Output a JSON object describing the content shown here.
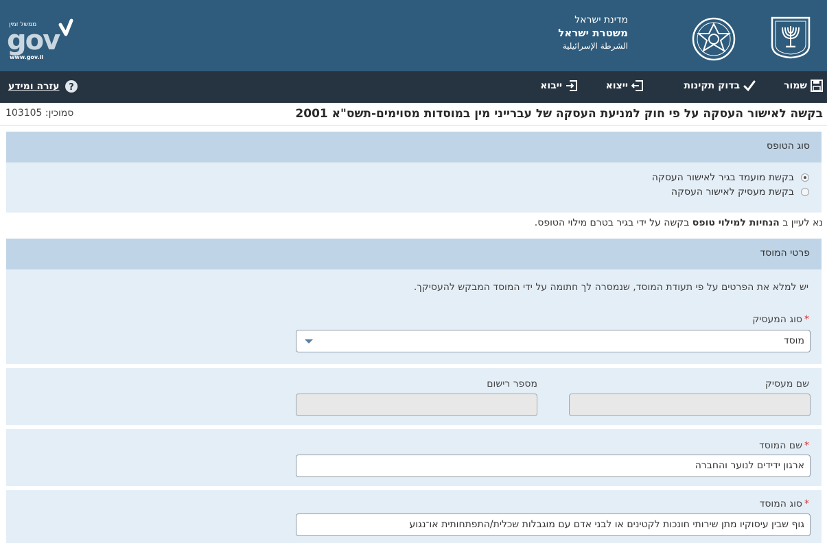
{
  "header": {
    "gov_logo_text": "gov",
    "gov_logo_tagline": "ממשל זמין",
    "gov_logo_url": "www.gov.il",
    "agency_line1": "מדינת ישראל",
    "agency_line2": "משטרת ישראל",
    "agency_line3": "الشرطة الإسرائيلية",
    "bg_color": "#2f5c7c"
  },
  "toolbar": {
    "save_label": "שמור",
    "check_label": "בדוק תקינות",
    "export_label": "ייצוא",
    "import_label": "ייבוא",
    "help_label": "עזרה ומידע"
  },
  "page": {
    "title": "בקשה לאישור העסקה על פי חוק למניעת העסקה של עברייני מין במוסדות מסוימים-תשס\"א 2001",
    "ref_label": "סמוכין:",
    "ref_value": "103105"
  },
  "form_type": {
    "section_title": "סוג הטופס",
    "options": [
      {
        "label": "בקשת מועמד בגיר לאישור העסקה",
        "selected": true
      },
      {
        "label": "בקשת מעסיק לאישור העסקה",
        "selected": false
      }
    ]
  },
  "notice": {
    "prefix": "נא לעיין ב ",
    "bold": "הנחיות למילוי טופס",
    "suffix": " בקשה על ידי בגיר בטרם מילוי הטופס."
  },
  "institution": {
    "section_title": "פרטי המוסד",
    "instructions": "יש למלא את הפרטים על פי תעודת המוסד, שנמסרה לך חתומה על ידי המוסד המבקש להעסיקך.",
    "employer_type_label": "סוג המעסיק",
    "employer_type_value": "מוסד",
    "employer_name_label": "שם מעסיק",
    "employer_name_value": "",
    "registration_label": "מספר רישום",
    "registration_value": "",
    "institution_name_label": "שם המוסד",
    "institution_name_value": "ארגון ידידים לנוער והחברה",
    "institution_type_label": "סוג המוסד",
    "institution_type_value": "גוף שבין עיסוקיו מתן שירותי חונכות לקטינים או לבני אדם עם מוגבלות שכלית/התפתחותית או־נגוע"
  }
}
